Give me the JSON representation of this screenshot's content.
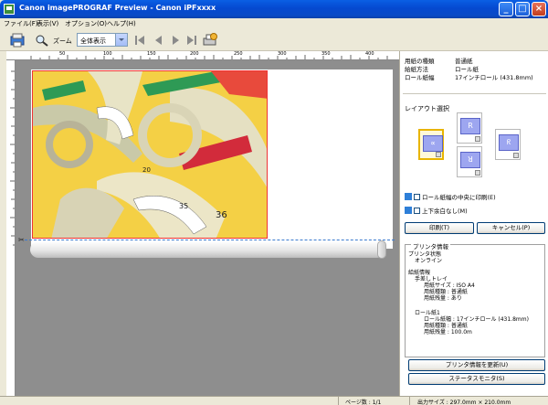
{
  "window": {
    "title": "Canon imagePROGRAF Preview - Canon iPFxxxx"
  },
  "menu": [
    "ファイル(F)",
    "表示(V)",
    "オプション(O)",
    "ヘルプ(H)"
  ],
  "toolbar": {
    "zoom_label": "ズーム",
    "zoom_value": "全体表示"
  },
  "ruler": {
    "top_ticks": [
      "50",
      "100",
      "150",
      "200",
      "250",
      "300",
      "350",
      "400"
    ]
  },
  "panel": {
    "info": [
      {
        "label": "用紙の種類",
        "value": "普通紙"
      },
      {
        "label": "給紙方法",
        "value": "ロール紙"
      },
      {
        "label": "ロール紙幅",
        "value": "17インチロール (431.8mm)"
      }
    ],
    "layout_title": "レイアウト選択",
    "center_print_label": "ロール紙幅の中央に印刷(E)",
    "no_margin_label": "上下余白なし(M)",
    "print_button": "印刷(T)",
    "cancel_button": "キャンセル(P)",
    "printer_info_title": "プリンタ情報",
    "printer_info_lines": [
      "プリンタ状態",
      "オンライン",
      "給紙情報",
      "手差しトレイ",
      "用紙サイズ : ISO A4",
      "用紙種類 : 普通紙",
      "用紙残量 : あり",
      "ロール紙1",
      "ロール紙幅 : 17インチロール (431.8mm)",
      "用紙種類 : 普通紙",
      "用紙残量 : 100.0m"
    ],
    "update_button": "プリンタ情報を更新(U)",
    "status_monitor_button": "ステータスモニタ(S)"
  },
  "status": {
    "page_count": "ページ数 : 1/1",
    "output_size": "出力サイズ : 297.0mm × 210.0mm"
  }
}
